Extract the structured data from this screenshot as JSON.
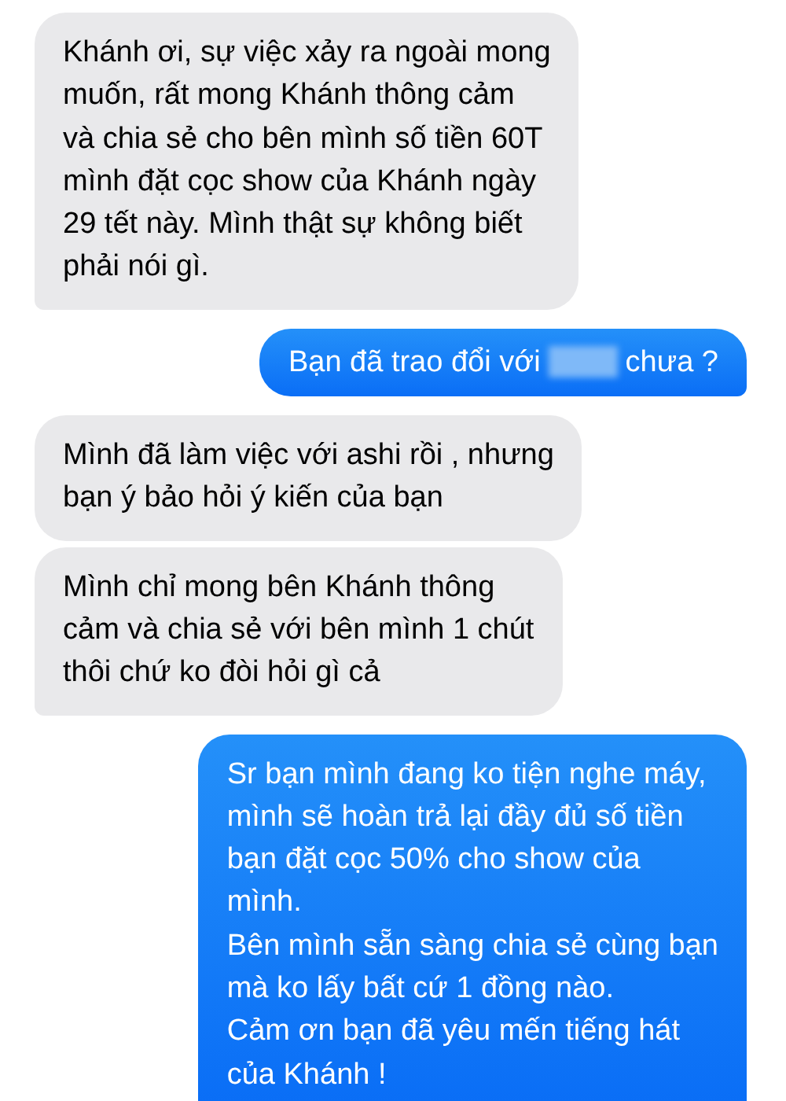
{
  "messages": [
    {
      "kind": "received",
      "tail": true,
      "parts": [
        {
          "kind": "text",
          "text": "Khánh ơi, sự việc xảy ra ngoài mong\nmuốn, rất mong Khánh thông cảm\nvà chia sẻ cho bên mình số tiền 60T\nmình đặt cọc show của Khánh ngày\n29 tết này. Mình thật sự không biết\nphải nói gì."
        }
      ]
    },
    {
      "kind": "sent",
      "tail": true,
      "parts": [
        {
          "kind": "text",
          "text": "Bạn đã trao đổi với"
        },
        {
          "kind": "redacted"
        },
        {
          "kind": "text",
          "text": "chưa ?"
        }
      ]
    },
    {
      "kind": "received",
      "tail": false,
      "parts": [
        {
          "kind": "text",
          "text": "Mình đã làm việc với ashi rồi , nhưng\nbạn ý bảo hỏi ý kiến của bạn"
        }
      ]
    },
    {
      "kind": "received",
      "tail": true,
      "parts": [
        {
          "kind": "text",
          "text": "Mình chỉ mong bên Khánh thông\ncảm và chia sẻ với bên mình 1 chút\nthôi chứ ko đòi hỏi gì cả"
        }
      ]
    },
    {
      "kind": "sent",
      "tail": false,
      "parts": [
        {
          "kind": "text",
          "text": "Sr bạn mình đang ko tiện nghe máy,\nmình sẽ hoàn trả lại đầy đủ số tiền\nbạn đặt cọc 50% cho show của\nmình.\nBên mình sẵn sàng chia sẻ cùng bạn\nmà ko lấy bất cứ 1 đồng nào.\nCảm ơn bạn đã yêu mến tiếng hát\ncủa Khánh !"
        }
      ]
    }
  ]
}
